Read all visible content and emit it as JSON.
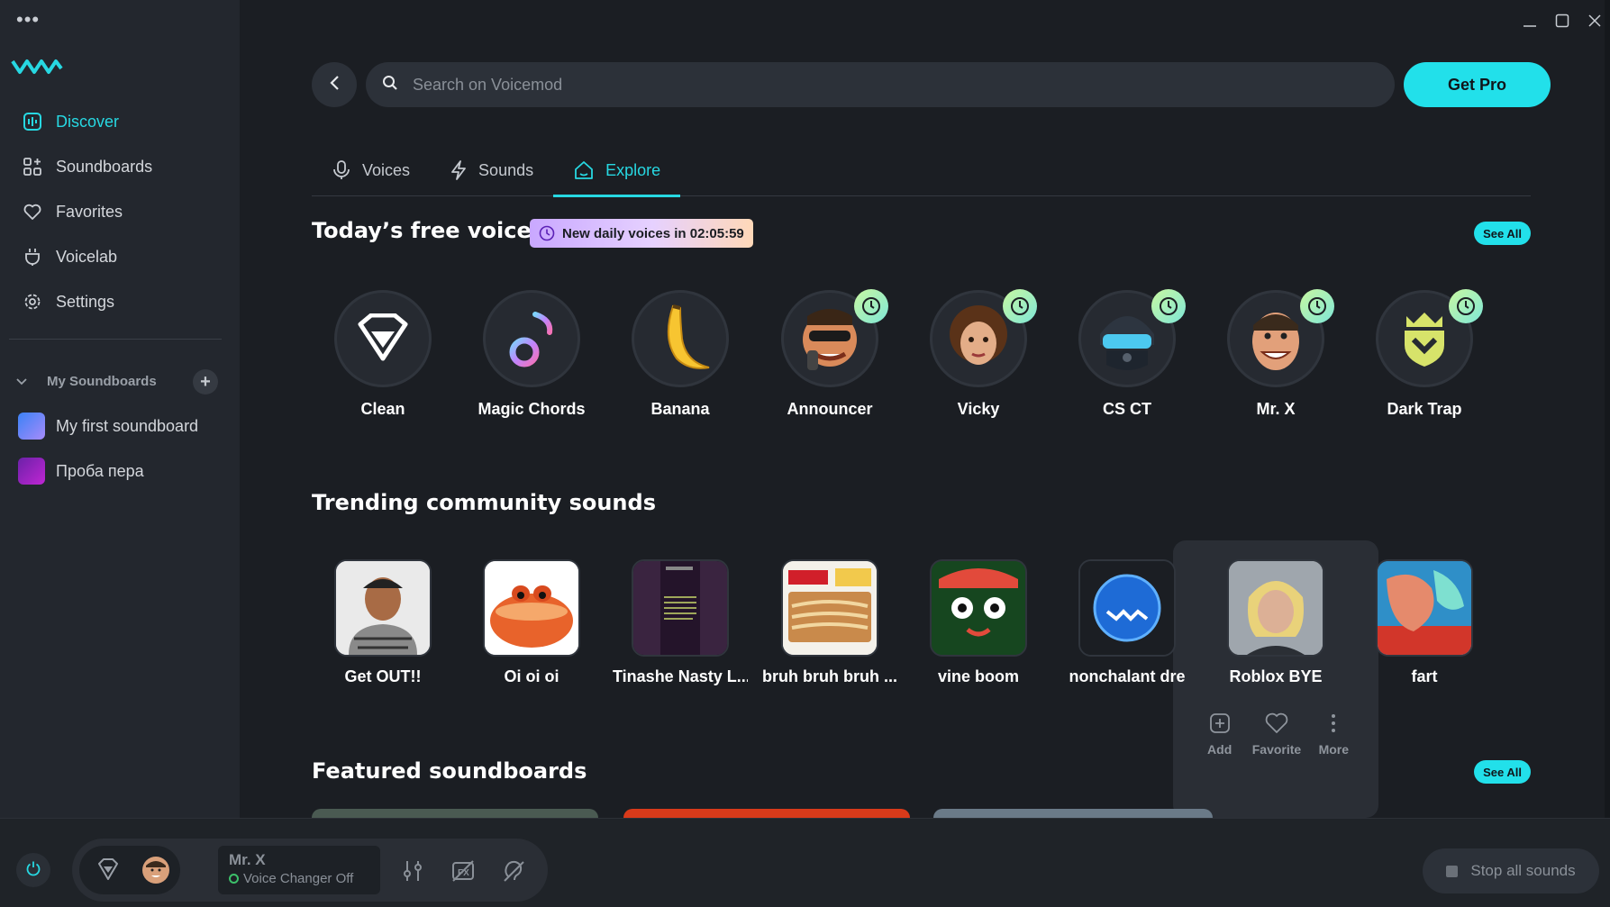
{
  "app": {
    "name": "Voicemod",
    "accent": "#22e0ea"
  },
  "window": {
    "menu_icon": "more-dots-icon"
  },
  "sidebar": {
    "items": [
      {
        "label": "Discover",
        "icon": "discover-icon",
        "active": true
      },
      {
        "label": "Soundboards",
        "icon": "soundboards-icon"
      },
      {
        "label": "Favorites",
        "icon": "heart-icon"
      },
      {
        "label": "Voicelab",
        "icon": "voicelab-icon"
      },
      {
        "label": "Settings",
        "icon": "gear-icon"
      }
    ],
    "my_soundboards_label": "My Soundboards",
    "soundboards": [
      {
        "label": "My first soundboard"
      },
      {
        "label": "Проба пера"
      }
    ]
  },
  "search": {
    "placeholder": "Search on Voicemod"
  },
  "get_pro_label": "Get Pro",
  "tabs": [
    {
      "label": "Voices",
      "icon": "mic-icon"
    },
    {
      "label": "Sounds",
      "icon": "lightning-icon"
    },
    {
      "label": "Explore",
      "icon": "home-icon",
      "active": true
    }
  ],
  "free_voices": {
    "title": "Today’s free voices",
    "badge": "New daily voices in 02:05:59",
    "see_all": "See All",
    "voices": [
      {
        "name": "Clean"
      },
      {
        "name": "Magic Chords"
      },
      {
        "name": "Banana"
      },
      {
        "name": "Announcer"
      },
      {
        "name": "Vicky"
      },
      {
        "name": "CS CT"
      },
      {
        "name": "Mr. X"
      },
      {
        "name": "Dark Trap"
      }
    ]
  },
  "trending": {
    "title": "Trending community sounds",
    "sounds": [
      {
        "name": "Get OUT!!"
      },
      {
        "name": "Oi oi oi"
      },
      {
        "name": "Tinashe Nasty L..."
      },
      {
        "name": "bruh bruh bruh ..."
      },
      {
        "name": "vine boom"
      },
      {
        "name": "nonchalant dre"
      },
      {
        "name": "Roblox BYE"
      },
      {
        "name": "fart"
      }
    ],
    "hover_actions": [
      {
        "label": "Add",
        "icon": "add-icon"
      },
      {
        "label": "Favorite",
        "icon": "heart-icon"
      },
      {
        "label": "More",
        "icon": "more-vertical-icon"
      }
    ]
  },
  "featured": {
    "title": "Featured soundboards",
    "see_all": "See All"
  },
  "bottombar": {
    "current_voice": "Mr. X",
    "voice_changer_status": "Voice Changer Off",
    "stop_all": "Stop all sounds"
  }
}
